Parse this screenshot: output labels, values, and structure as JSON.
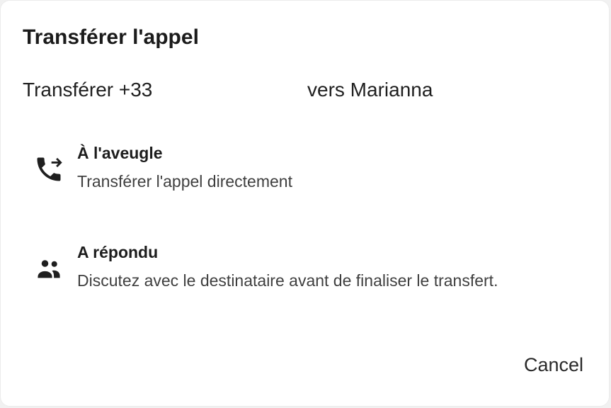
{
  "dialog": {
    "title": "Transférer l'appel",
    "transfer_prefix": "Transférer +33",
    "transfer_target": "vers Marianna",
    "options": [
      {
        "title": "À l'aveugle",
        "description": "Transférer l'appel directement",
        "icon": "phone-forward-icon"
      },
      {
        "title": "A répondu",
        "description": "Discutez avec le destinataire avant de finaliser le transfert.",
        "icon": "people-icon"
      }
    ],
    "cancel_label": "Cancel"
  },
  "colors": {
    "background": "#ffffff",
    "text_primary": "#1b1b1b",
    "text_secondary": "#3f3f3f",
    "icon": "#1f1f1f"
  }
}
